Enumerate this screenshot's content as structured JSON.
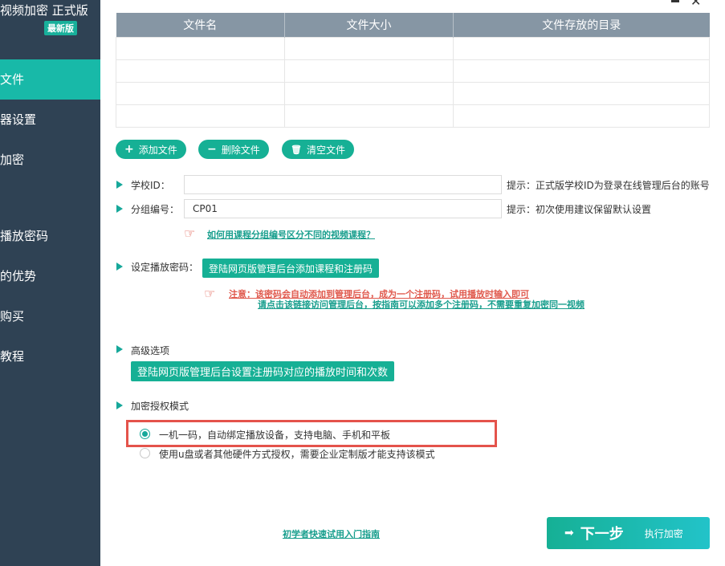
{
  "sidebar": {
    "app_title": "视频加密 正式版",
    "badge": "最新版",
    "items": [
      {
        "label": "文件"
      },
      {
        "label": "器设置"
      },
      {
        "label": "加密"
      },
      {
        "label": "播放密码"
      },
      {
        "label": "的优势"
      },
      {
        "label": "购买"
      },
      {
        "label": "教程"
      }
    ]
  },
  "window": {
    "close_glyph": "✕"
  },
  "file_table": {
    "columns": [
      "文件名",
      "文件大小",
      "文件存放的目录"
    ]
  },
  "file_buttons": {
    "add": "添加文件",
    "delete": "删除文件",
    "clear": "清空文件"
  },
  "form": {
    "school_id_label": "学校ID：",
    "school_id_value": "",
    "school_id_hint": "提示：正式版学校ID为登录在线管理后台的账号",
    "group_label": "分组编号：",
    "group_value": "CP01",
    "group_hint": "提示：初次使用建议保留默认设置",
    "group_link": "如何用课程分组编号区分不同的视频课程？"
  },
  "password": {
    "label": "设定播放密码：",
    "button": "登陆网页版管理后台添加课程和注册码",
    "note_line1": "注意：该密码会自动添加到管理后台，成为一个注册码，试用播放时输入即可",
    "note_line2": "请点击该链接访问管理后台，按指南可以添加多个注册码，不需要重复加密同一视频"
  },
  "advanced": {
    "label": "高级选项",
    "button": "登陆网页版管理后台设置注册码对应的播放时间和次数"
  },
  "auth_mode": {
    "label": "加密授权模式",
    "options": [
      {
        "label": "一机一码，自动绑定播放设备，支持电脑、手机和平板",
        "selected": true
      },
      {
        "label": "使用u盘或者其他硬件方式授权，需要企业定制版才能支持该模式",
        "selected": false
      }
    ]
  },
  "footer": {
    "guide_link": "初学者快速试用入门指南",
    "next_label": "下一步",
    "next_sub": "执行加密"
  },
  "colors": {
    "accent": "#16b095",
    "sidebar_bg": "#2f4254",
    "highlight_box": "#e4534b"
  }
}
